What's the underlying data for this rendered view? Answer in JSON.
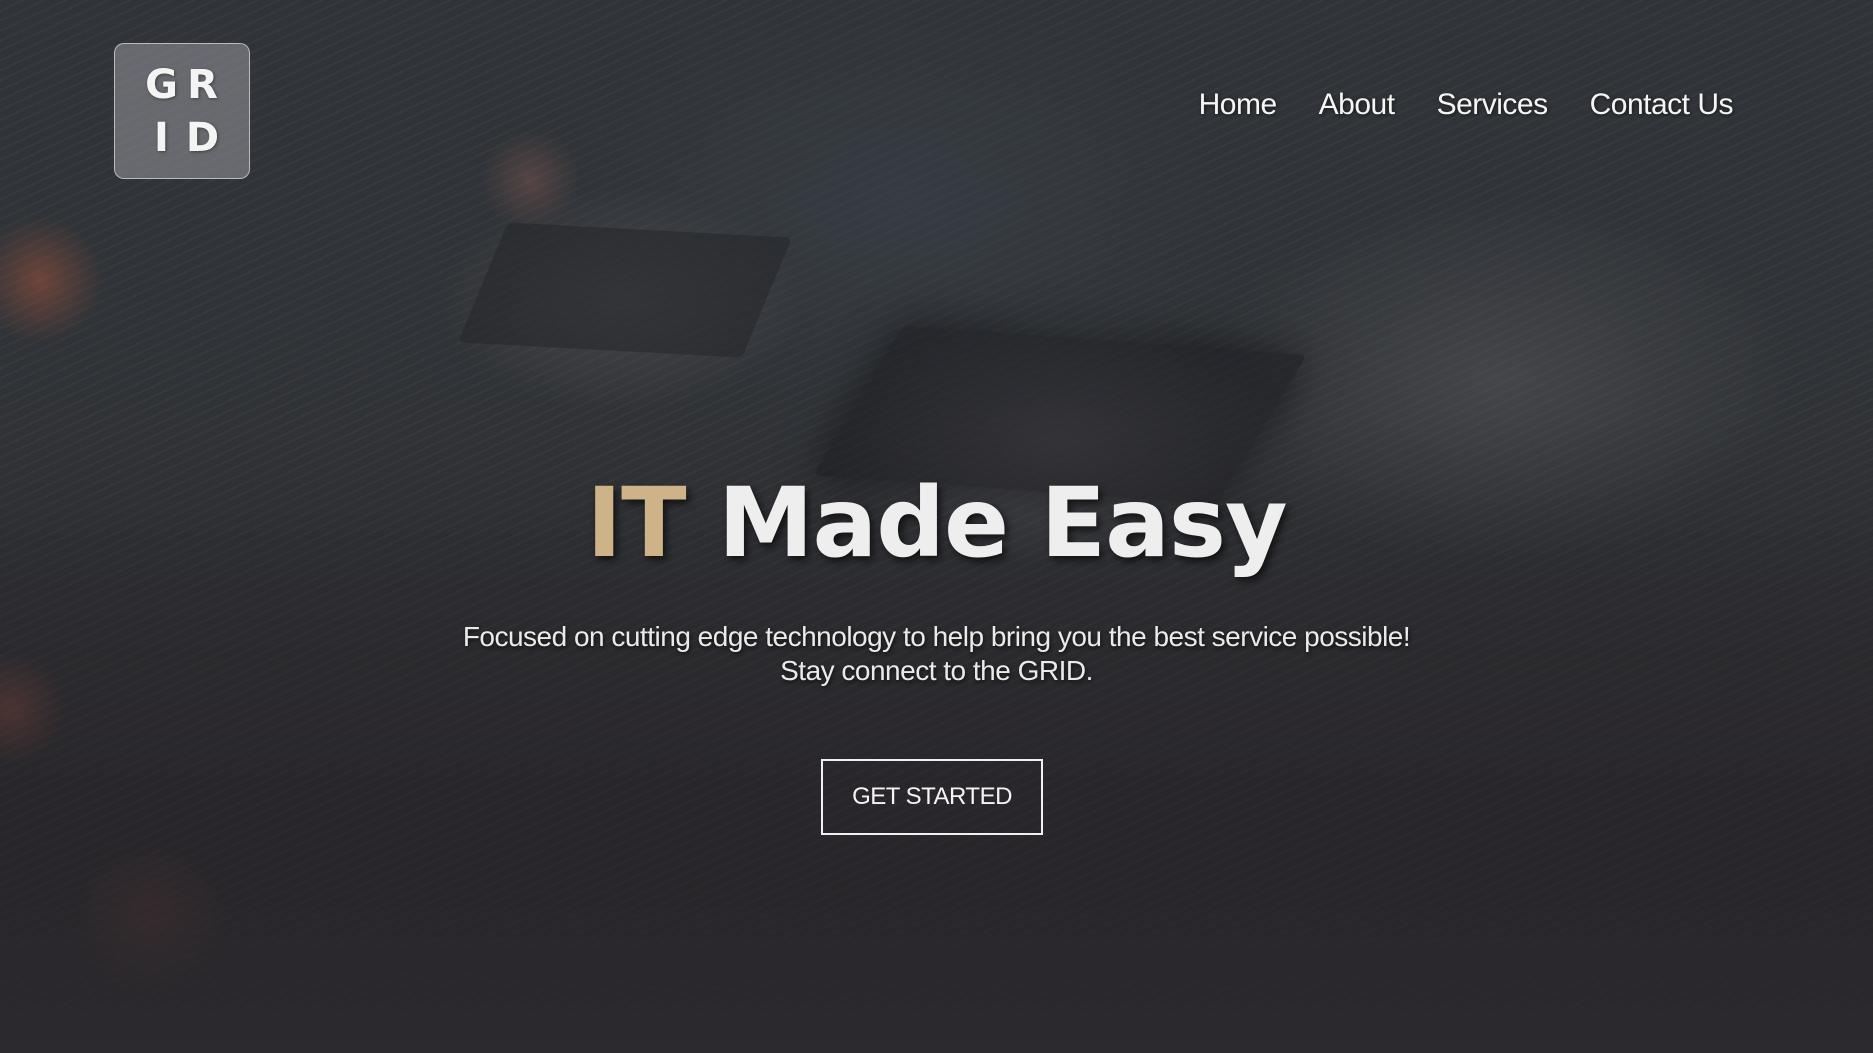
{
  "logo": {
    "letters": [
      "G",
      "R",
      "I",
      "D"
    ]
  },
  "nav": {
    "items": [
      {
        "label": "Home"
      },
      {
        "label": "About"
      },
      {
        "label": "Services"
      },
      {
        "label": "Contact Us"
      }
    ]
  },
  "hero": {
    "headline_accent": "IT",
    "headline_rest": "Made Easy",
    "tagline_line1": "Focused on cutting edge technology to help bring you the best service possible!",
    "tagline_line2": "Stay connect to the GRID.",
    "cta_label": "GET STARTED"
  },
  "colors": {
    "accent": "#cdb387",
    "text": "#ffffff"
  }
}
